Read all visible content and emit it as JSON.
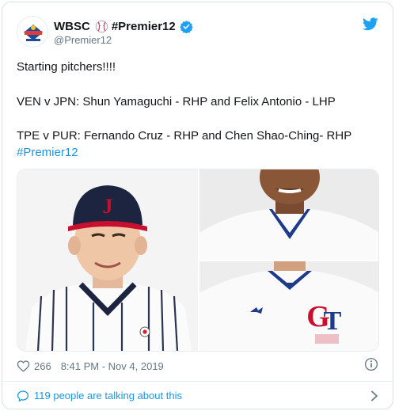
{
  "user": {
    "display_name": "WBSC",
    "name_hashtag": "#Premier12",
    "handle": "@Premier12"
  },
  "tweet": {
    "line1": "Starting pitchers!!!!",
    "line2": "VEN v JPN: Shun Yamaguchi - RHP and  Felix Antonio - LHP",
    "line3": "TPE  v PUR: Fernando Cruz - RHP and Chen Shao-Ching- RHP",
    "hashtag": "#Premier12"
  },
  "meta": {
    "likes": "266",
    "timestamp": "8:41 PM - Nov 4, 2019"
  },
  "footer": {
    "talk_text": "119 people are talking about this"
  },
  "colors": {
    "link_blue": "#1b95e0",
    "twitter_blue": "#1da1f2",
    "text": "#14171a",
    "muted": "#657786"
  },
  "icons": {
    "avatar": "wbsc-premier12-logo",
    "ball": "baseball-icon",
    "verified": "verified-badge-icon",
    "brand": "twitter-bird-icon",
    "like": "heart-icon",
    "info": "info-icon",
    "talk": "speech-bubble-icon",
    "more": "chevron-right-icon"
  }
}
